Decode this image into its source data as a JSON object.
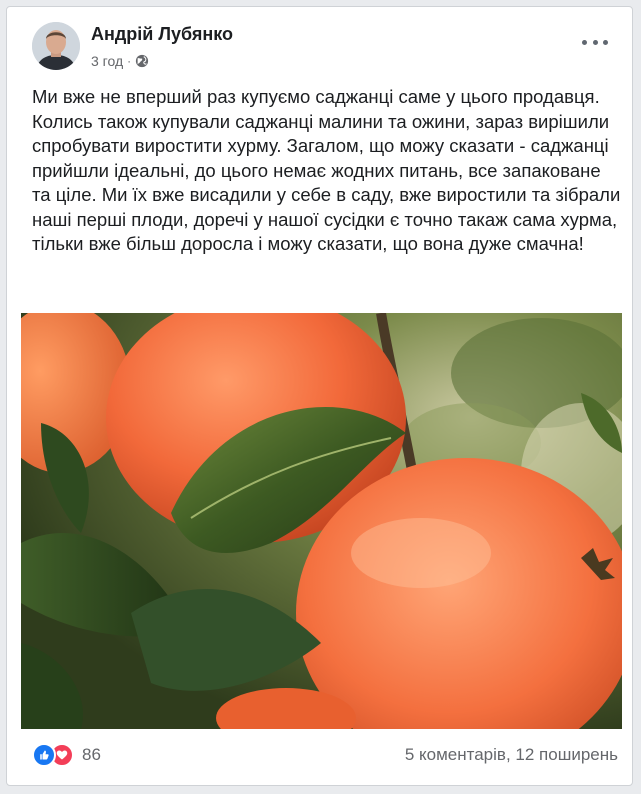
{
  "post": {
    "author": "Андрій Лубянко",
    "time": "3 год",
    "separator": "·",
    "text": "Ми вже не вперший раз купуємо саджанці саме у цього продавця. Колись також купували саджанці малини та ожини, зараз вирішили спробувати виростити хурму. Загалом, що можу сказати - саджанці прийшли ідеальні, до цього немає жодних питань, все запаковане та ціле. Ми їх вже висадили у себе в саду, вже виростили та зібрали наші перші плоди, доречі у нашої сусідки є точно такаж сама хурма, тільки вже більш доросла і можу сказати, що вона дуже смачна!",
    "photo_subject": "persimmons-on-branch"
  },
  "footer": {
    "reaction_count": "86",
    "comments": "5 коментарів",
    "stats_separator": ", ",
    "shares": "12 поширень"
  },
  "icons": {
    "privacy": "globe-icon",
    "menu": "more-options-icon",
    "reactions": [
      "like-icon",
      "love-icon"
    ]
  },
  "colors": {
    "like": "#1877f2",
    "love": "#f33e58",
    "meta_text": "#65676b",
    "main_text": "#1c1e21"
  }
}
